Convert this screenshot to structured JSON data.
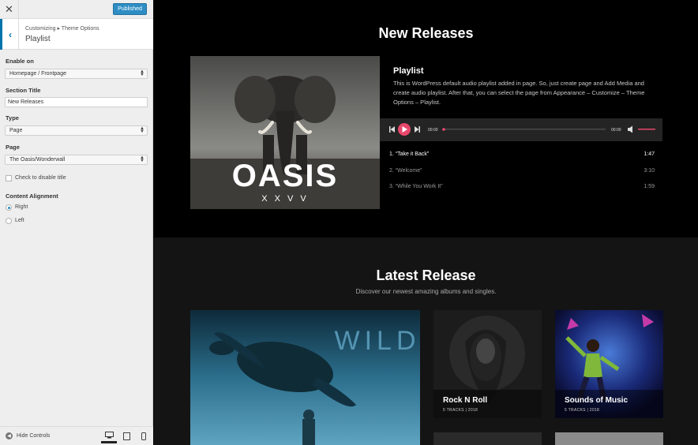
{
  "sidebar": {
    "close_icon": "✕",
    "publish_label": "Published",
    "breadcrumb": "Customizing ▸ Theme Options",
    "section_title": "Playlist",
    "enable_on_label": "Enable on",
    "enable_on_value": "Homepage / Frontpage",
    "section_title_label": "Section Title",
    "section_title_value": "New Releases",
    "type_label": "Type",
    "type_value": "Page",
    "page_label": "Page",
    "page_value": "The Oasis/Wonderwall",
    "disable_title_label": "Check to disable title",
    "alignment_label": "Content Alignment",
    "align_right": "Right",
    "align_left": "Left",
    "hide_controls": "Hide Controls",
    "accent": "#0073aa"
  },
  "preview": {
    "new_releases_heading": "New Releases",
    "art_title": "OASIS",
    "art_sub": "X X V V",
    "playlist_title": "Playlist",
    "playlist_desc": "This is WordPress default audio playlist added in page. So, just create page and Add Media and create audio playlist. After that, you can select the page from Appearance – Customize – Theme Options – Playlist.",
    "time_current": "00:00",
    "time_total": "00:00",
    "tracks": [
      {
        "name": "1. “Take it Back”",
        "len": "1:47"
      },
      {
        "name": "2. “Welcome”",
        "len": "3:10"
      },
      {
        "name": "3. “While You Work It”",
        "len": "1:59"
      }
    ],
    "latest_heading": "Latest Release",
    "latest_sub": "Discover our newest amazing albums and singles.",
    "wild_text": "WILD",
    "tiles": [
      {
        "name": "Rock N Roll",
        "meta": "5 TRACKS  |  2018"
      },
      {
        "name": "Sounds of Music",
        "meta": "5 TRACKS  |  2018"
      }
    ],
    "player_accent": "#e8476b"
  }
}
